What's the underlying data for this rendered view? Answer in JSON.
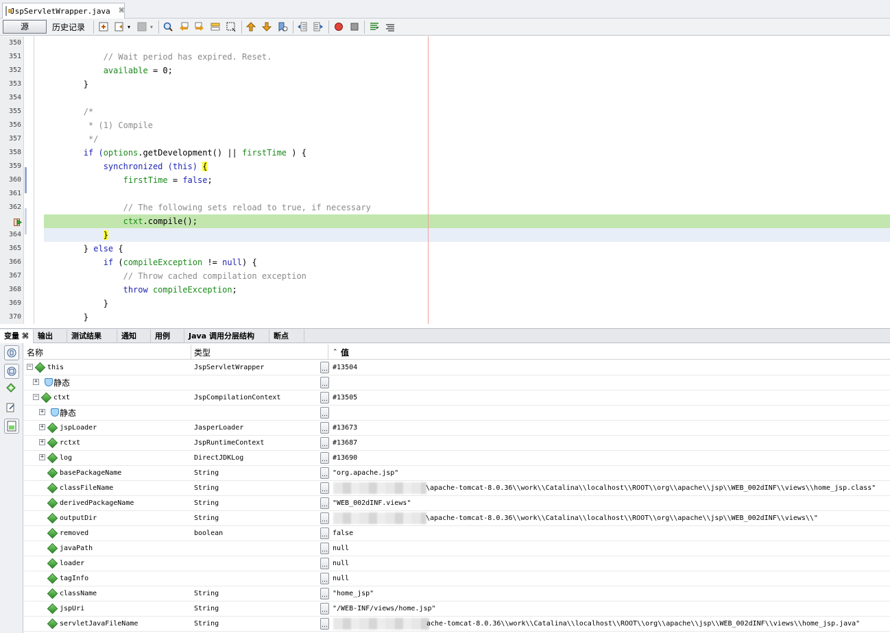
{
  "file_tab": {
    "name": "JspServletWrapper.java",
    "close": "⌘"
  },
  "toolbar": {
    "source_label": "源",
    "history_label": "历史记录"
  },
  "colors": {
    "current_line": "#c2e6ae",
    "caret_line": "#e8eef8",
    "keyword": "#1f24b4",
    "field": "#1a8a1a",
    "comment": "#8a8a8a"
  },
  "line_numbers": [
    "350",
    "351",
    "352",
    "353",
    "354",
    "355",
    "356",
    "357",
    "358",
    "359",
    "360",
    "361",
    "362",
    "",
    "364",
    "365",
    "366",
    "367",
    "368",
    "369",
    "370"
  ],
  "code": {
    "l351": "// Wait period has expired. Reset.",
    "l352a": "available",
    "l352b": " = 0;",
    "l353": "}",
    "l355": "/*",
    "l356": " * (1) Compile",
    "l357": " */",
    "l358a": "if (",
    "l358b": "options",
    "l358c": ".getDevelopment() || ",
    "l358d": "firstTime",
    "l358e": " ) {",
    "l359a": "synchronized",
    "l359b": " (this) ",
    "l359c": "{",
    "l360a": "firstTime",
    "l360b": " = ",
    "l360c": "false",
    "l360d": ";",
    "l362": "// The following sets reload to true, if necessary",
    "l363a": "ctxt",
    "l363b": ".compile();",
    "l364": "}",
    "l365a": "} ",
    "l365b": "else",
    "l365c": " {",
    "l366a": "if",
    "l366b": " (",
    "l366c": "compileException",
    "l366d": " != ",
    "l366e": "null",
    "l366f": ") {",
    "l367": "// Throw cached compilation exception",
    "l368a": "throw",
    "l368b": " compileException",
    "l368c": ";",
    "l369": "}",
    "l370": "}"
  },
  "bottom_tabs": [
    "变量 ⌘",
    "输出",
    "测试结果",
    "通知",
    "用例",
    "Java 调用分层结构",
    "断点"
  ],
  "variables": {
    "columns": {
      "name": "名称",
      "type": "类型",
      "value": "值"
    },
    "rows": [
      {
        "name": "this",
        "type": "JspServletWrapper",
        "value": "#13504",
        "expander": "⊟"
      },
      {
        "name": "静态",
        "type": "",
        "value": "",
        "expander": "⊞"
      },
      {
        "name": "ctxt",
        "type": "JspCompilationContext",
        "value": "#13505",
        "expander": "⊟"
      },
      {
        "name": "静态",
        "type": "",
        "value": "",
        "expander": "⊞"
      },
      {
        "name": "jspLoader",
        "type": "JasperLoader",
        "value": "#13673",
        "expander": "⊞"
      },
      {
        "name": "rctxt",
        "type": "JspRuntimeContext",
        "value": "#13687",
        "expander": "⊞"
      },
      {
        "name": "log",
        "type": "DirectJDKLog",
        "value": "#13690",
        "expander": "⊞"
      },
      {
        "name": "basePackageName",
        "type": "String",
        "value": "\"org.apache.jsp\""
      },
      {
        "name": "classFileName",
        "type": "String",
        "value": "\\apache-tomcat-8.0.36\\\\work\\\\Catalina\\\\localhost\\\\ROOT\\\\org\\\\apache\\\\jsp\\\\WEB_002dINF\\\\views\\\\home_jsp.class\""
      },
      {
        "name": "derivedPackageName",
        "type": "String",
        "value": "\"WEB_002dINF.views\""
      },
      {
        "name": "outputDir",
        "type": "String",
        "value": "\\apache-tomcat-8.0.36\\\\work\\\\Catalina\\\\localhost\\\\ROOT\\\\org\\\\apache\\\\jsp\\\\WEB_002dINF\\\\views\\\\\""
      },
      {
        "name": "removed",
        "type": "boolean",
        "value": "false"
      },
      {
        "name": "javaPath",
        "type": "",
        "value": "null"
      },
      {
        "name": "loader",
        "type": "",
        "value": "null"
      },
      {
        "name": "tagInfo",
        "type": "",
        "value": "null"
      },
      {
        "name": "className",
        "type": "String",
        "value": "\"home_jsp\""
      },
      {
        "name": "jspUri",
        "type": "String",
        "value": "\"/WEB-INF/views/home.jsp\""
      },
      {
        "name": "servletJavaFileName",
        "type": "String",
        "value": "ache-tomcat-8.0.36\\\\work\\\\Catalina\\\\localhost\\\\ROOT\\\\org\\\\apache\\\\jsp\\\\WEB_002dINF\\\\views\\\\home_jsp.java\""
      }
    ]
  }
}
